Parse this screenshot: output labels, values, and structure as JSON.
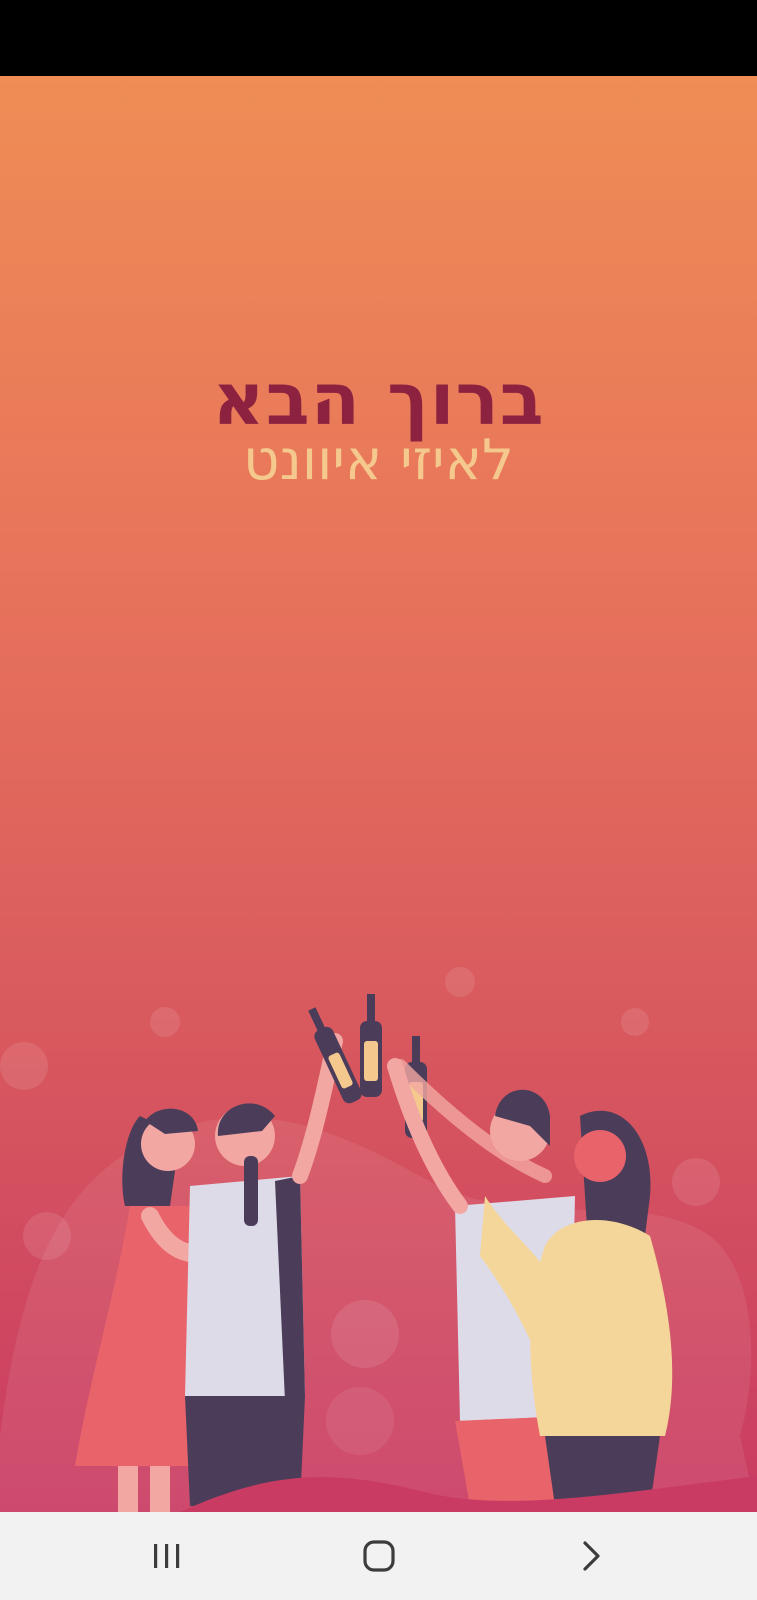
{
  "splash": {
    "title": "ברוך הבא",
    "subtitle": "לאיזי איוונט"
  },
  "colors": {
    "status_bar": "#000000",
    "gradient_top": "#ef8d55",
    "gradient_bottom": "#c93b62",
    "title": "#8c2240",
    "subtitle": "#f5c98e",
    "nav_bar": "#f3f2f2",
    "nav_icon": "#3c3c3c"
  },
  "illustration": {
    "subject": "four friends toasting with bottles"
  },
  "navigation": {
    "recents_icon": "recents-icon",
    "home_icon": "home-icon",
    "back_icon": "back-icon"
  }
}
